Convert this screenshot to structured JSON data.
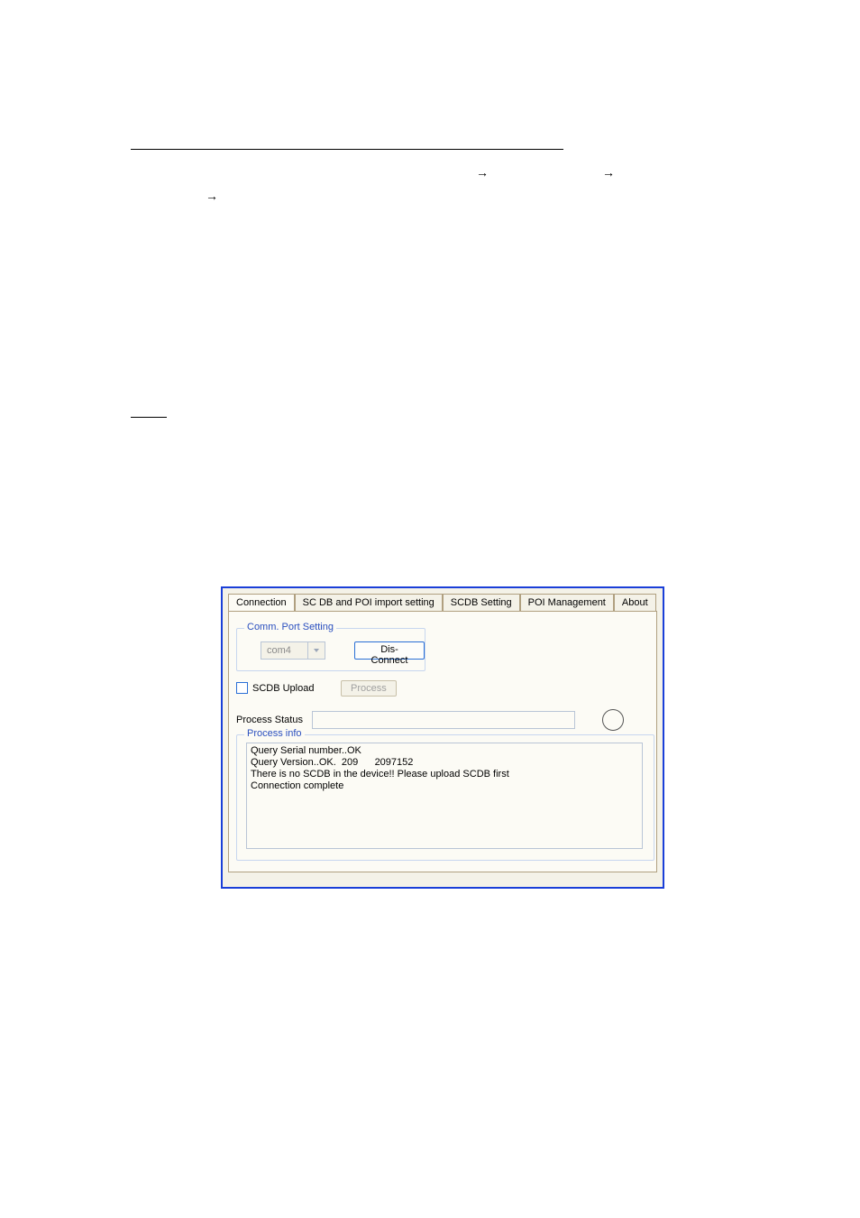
{
  "doc": {
    "arrow1": "→",
    "arrow2": "→",
    "arrow3": "→"
  },
  "tabs": {
    "connection": "Connection",
    "scdb_import": "SC DB and POI import setting",
    "scdb_setting": "SCDB  Setting",
    "poi_mgmt": "POI Management",
    "about": "About"
  },
  "commport": {
    "group_title": "Comm. Port Setting",
    "selected": "com4",
    "disconnect": "Dis-Connect"
  },
  "upload": {
    "checkbox_label": "SCDB Upload",
    "process_btn": "Process"
  },
  "status": {
    "label": "Process Status"
  },
  "procinfo": {
    "group_title": "Process info",
    "lines": "Query Serial number..OK\nQuery Version..OK.  209      2097152\nThere is no SCDB in the device!! Please upload SCDB first\nConnection complete"
  }
}
